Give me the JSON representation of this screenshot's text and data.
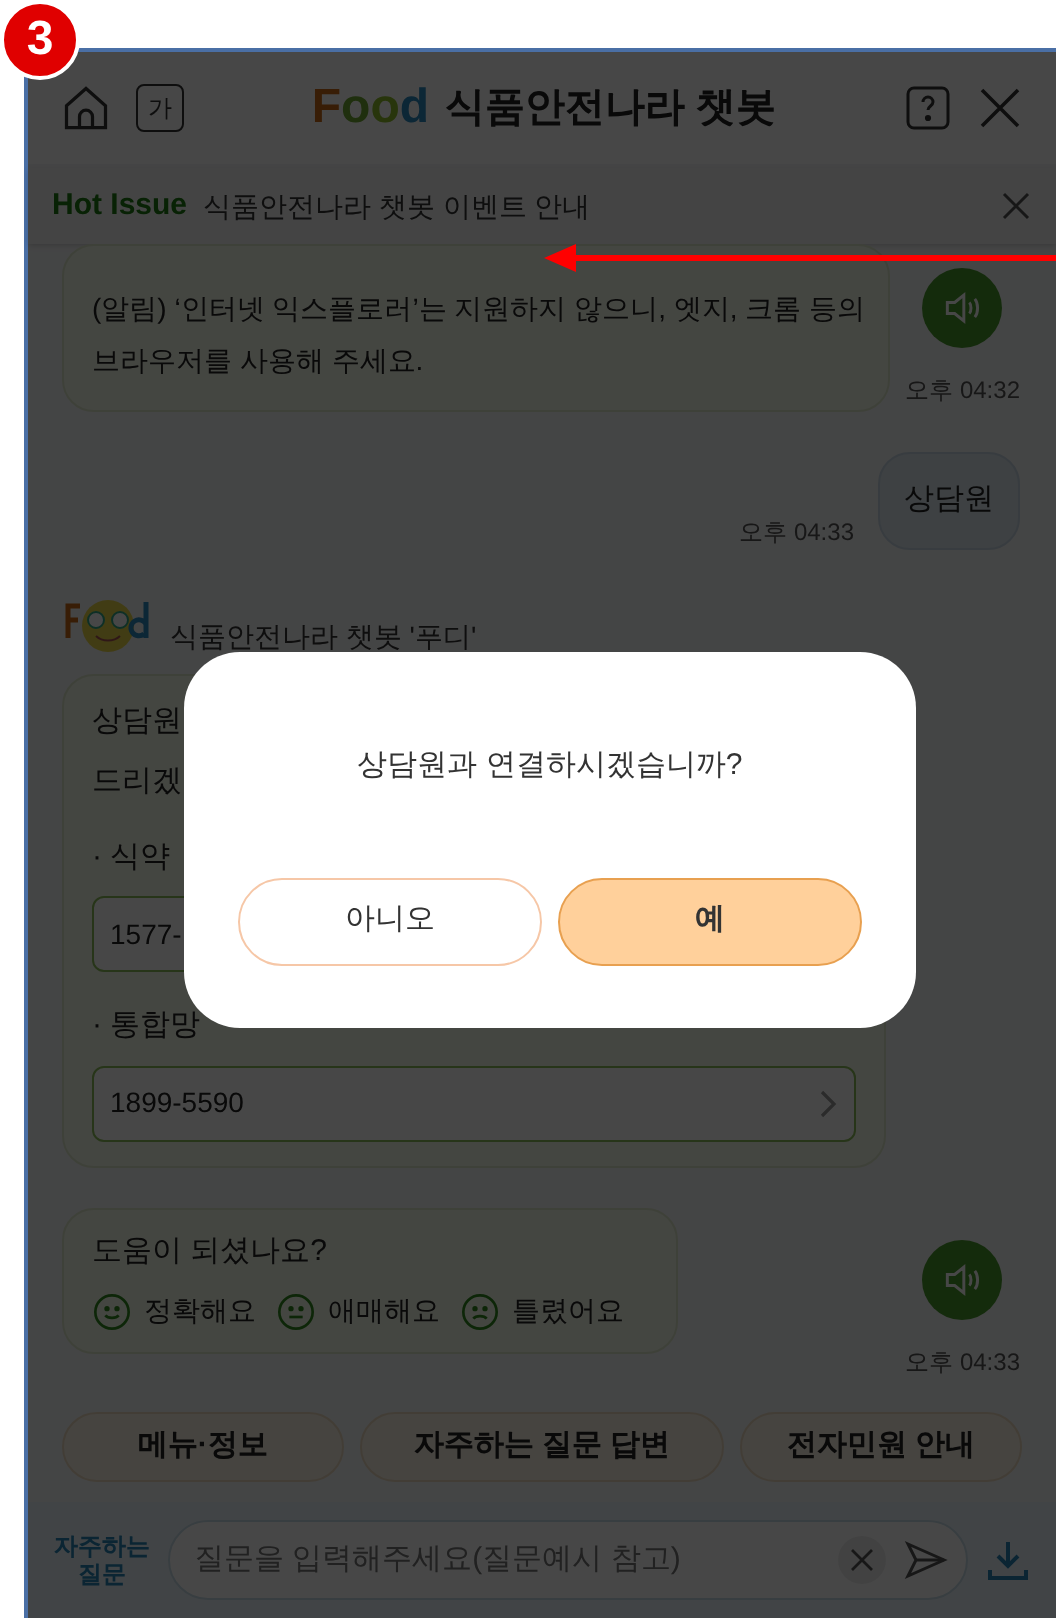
{
  "step_badge": "3",
  "header": {
    "logo": "Food",
    "title": "식품안전나라 챗봇",
    "font_button": "가"
  },
  "hot_issue": {
    "label": "Hot Issue",
    "text": "식품안전나라 챗봇 이벤트 안내"
  },
  "messages": [
    {
      "kind": "bot_notice",
      "text": "(알림) ‘인터넷 익스플로러’는 지원하지 않으니, 엣지, 크롬 등의 브라우저를 사용해 주세요.",
      "time": "오후 04:32"
    },
    {
      "kind": "user",
      "text": "상담원",
      "time": "오후 04:33"
    },
    {
      "kind": "bot_card",
      "sender": "식품안전나라 챗봇 '푸디'",
      "lines": [
        "상담원",
        "드리겠"
      ],
      "items": [
        {
          "label": "· 식약",
          "number": "1577-"
        },
        {
          "label": "· 통합망",
          "number": "1899-5590"
        }
      ]
    },
    {
      "kind": "feedback",
      "question": "도움이 되셨나요?",
      "time": "오후 04:33",
      "options": [
        {
          "kind": "smile",
          "label": "정확해요"
        },
        {
          "kind": "neutral",
          "label": "애매해요"
        },
        {
          "kind": "frown",
          "label": "틀렸어요"
        }
      ]
    }
  ],
  "quick_buttons": [
    "메뉴·정보",
    "자주하는 질문 답변",
    "전자민원 안내"
  ],
  "input_bar": {
    "faq_label": "자주하는\n질문",
    "placeholder": "질문을 입력해주세요(질문예시 참고)"
  },
  "dialog": {
    "message": "상담원과 연결하시겠습니까?",
    "buttons": [
      {
        "label": "아니오",
        "primary": false
      },
      {
        "label": "예",
        "primary": true
      }
    ]
  }
}
